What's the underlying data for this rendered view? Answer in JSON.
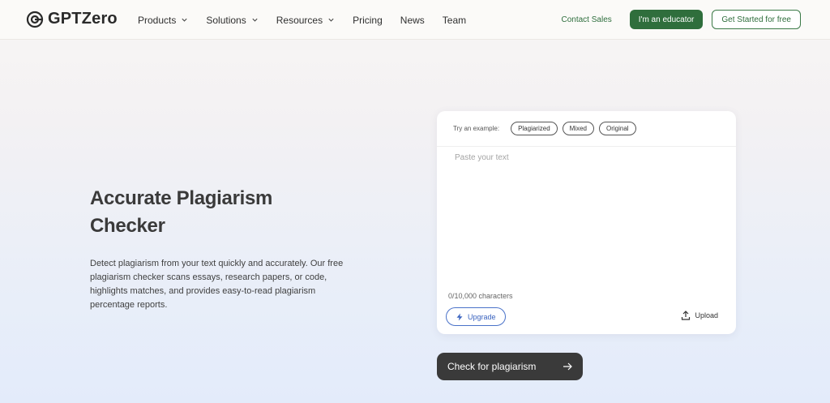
{
  "brand": {
    "name": "GPTZero"
  },
  "nav": {
    "items": [
      {
        "label": "Products",
        "has_menu": true
      },
      {
        "label": "Solutions",
        "has_menu": true
      },
      {
        "label": "Resources",
        "has_menu": true
      },
      {
        "label": "Pricing",
        "has_menu": false
      },
      {
        "label": "News",
        "has_menu": false
      },
      {
        "label": "Team",
        "has_menu": false
      }
    ],
    "contact_sales": "Contact Sales",
    "educator_button": "I'm an educator",
    "get_started_button": "Get Started for free"
  },
  "hero": {
    "title": "Accurate Plagiarism Checker",
    "description": "Detect plagiarism from your text quickly and accurately. Our free plagiarism checker scans essays, research papers, or code, highlights matches, and provides easy-to-read plagiarism percentage reports."
  },
  "checker": {
    "try_label": "Try an example:",
    "examples": [
      "Plagiarized",
      "Mixed",
      "Original"
    ],
    "text_placeholder": "Paste your text",
    "text_value": "",
    "char_count": "0/10,000 characters",
    "upgrade_button": "Upgrade",
    "upload_button": "Upload",
    "submit_button": "Check for plagiarism"
  },
  "colors": {
    "brand_green": "#2f6e3c",
    "upgrade_blue": "#3a63bf",
    "cta_dark": "#3a3a3a"
  },
  "icons": {
    "logo": "gptzero-logo-icon",
    "nav_dropdown": "chevron-down-icon",
    "upgrade": "lightning-icon",
    "upload": "upload-icon",
    "submit": "arrow-right-icon"
  }
}
